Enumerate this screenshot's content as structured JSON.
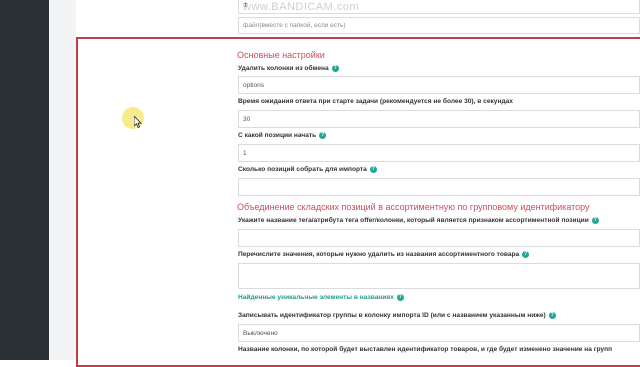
{
  "watermark": "www.BANDICAM.com",
  "top": {
    "field1_text": "Ф",
    "field2_placeholder": "файл(вместе с папкой, если есть)"
  },
  "basic": {
    "title": "Основные настройки",
    "delete_cols_label": "Удалить колонки из обмена",
    "delete_cols_value": "options",
    "timeout_label": "Время ожидания ответа при старте задачи (рекомендуется не более 30), в секундах",
    "timeout_value": "30",
    "start_pos_label": "С какой позиции начать",
    "start_pos_value": "1",
    "count_label": "Сколько позиций собрать для импорта",
    "count_value": ""
  },
  "merge": {
    "title": "Объединение складских позиций в ассортиментную по групповому идентификатору",
    "tag_label": "Укажите название тега/атрибута тега offer/колонки, который является признаком ассортиментной позиции",
    "remove_label": "Перечислите значения, которые нужно удалить из названия ассортиментного товара",
    "unique_link": "Найденные уникальные элементы в названиях",
    "write_id_label": "Записывать идентификатор группы в колонку импорта ID (или с названием указанным ниже)",
    "write_id_value": "Выключено",
    "column_name_label": "Название колонки, по которой будет выставлен идентификатор товаров, и где будет изменено значение на групп"
  },
  "colors": {
    "accent": "#c43c45",
    "help": "#22a695",
    "link": "#1e9e8f",
    "sidebar": "#2b3037"
  }
}
